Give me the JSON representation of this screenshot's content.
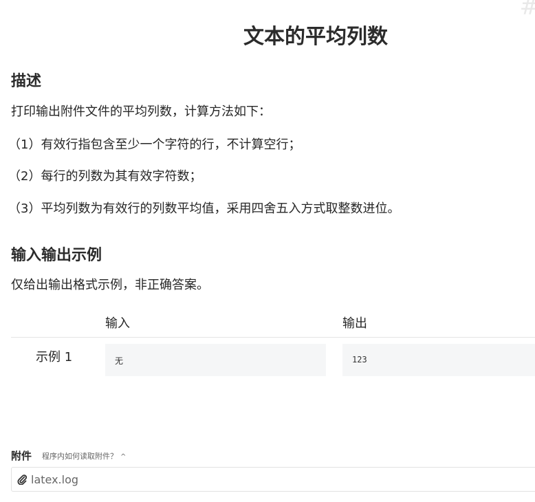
{
  "title": "文本的平均列数",
  "sections": {
    "description": {
      "heading": "描述",
      "intro": "打印输出附件文件的平均列数，计算方法如下：",
      "items": [
        "（1）有效行指包含至少一个字符的行，不计算空行；",
        "（2）每行的列数为其有效字符数；",
        "（3）平均列数为有效行的列数平均值，采用四舍五入方式取整数进位。"
      ]
    },
    "examples": {
      "heading": "输入输出示例",
      "note": "仅给出输出格式示例，非正确答案。",
      "columns": {
        "input": "输入",
        "output": "输出"
      },
      "rows": [
        {
          "label": "示例 1",
          "input": "无",
          "output": "123"
        }
      ]
    }
  },
  "attachment": {
    "label": "附件",
    "help_link": "程序内如何读取附件？",
    "file_name": "latex.log"
  },
  "icons": {
    "help_toggle": "chevron-up-icon",
    "file": "paperclip-icon",
    "corner": "hash-icon"
  }
}
